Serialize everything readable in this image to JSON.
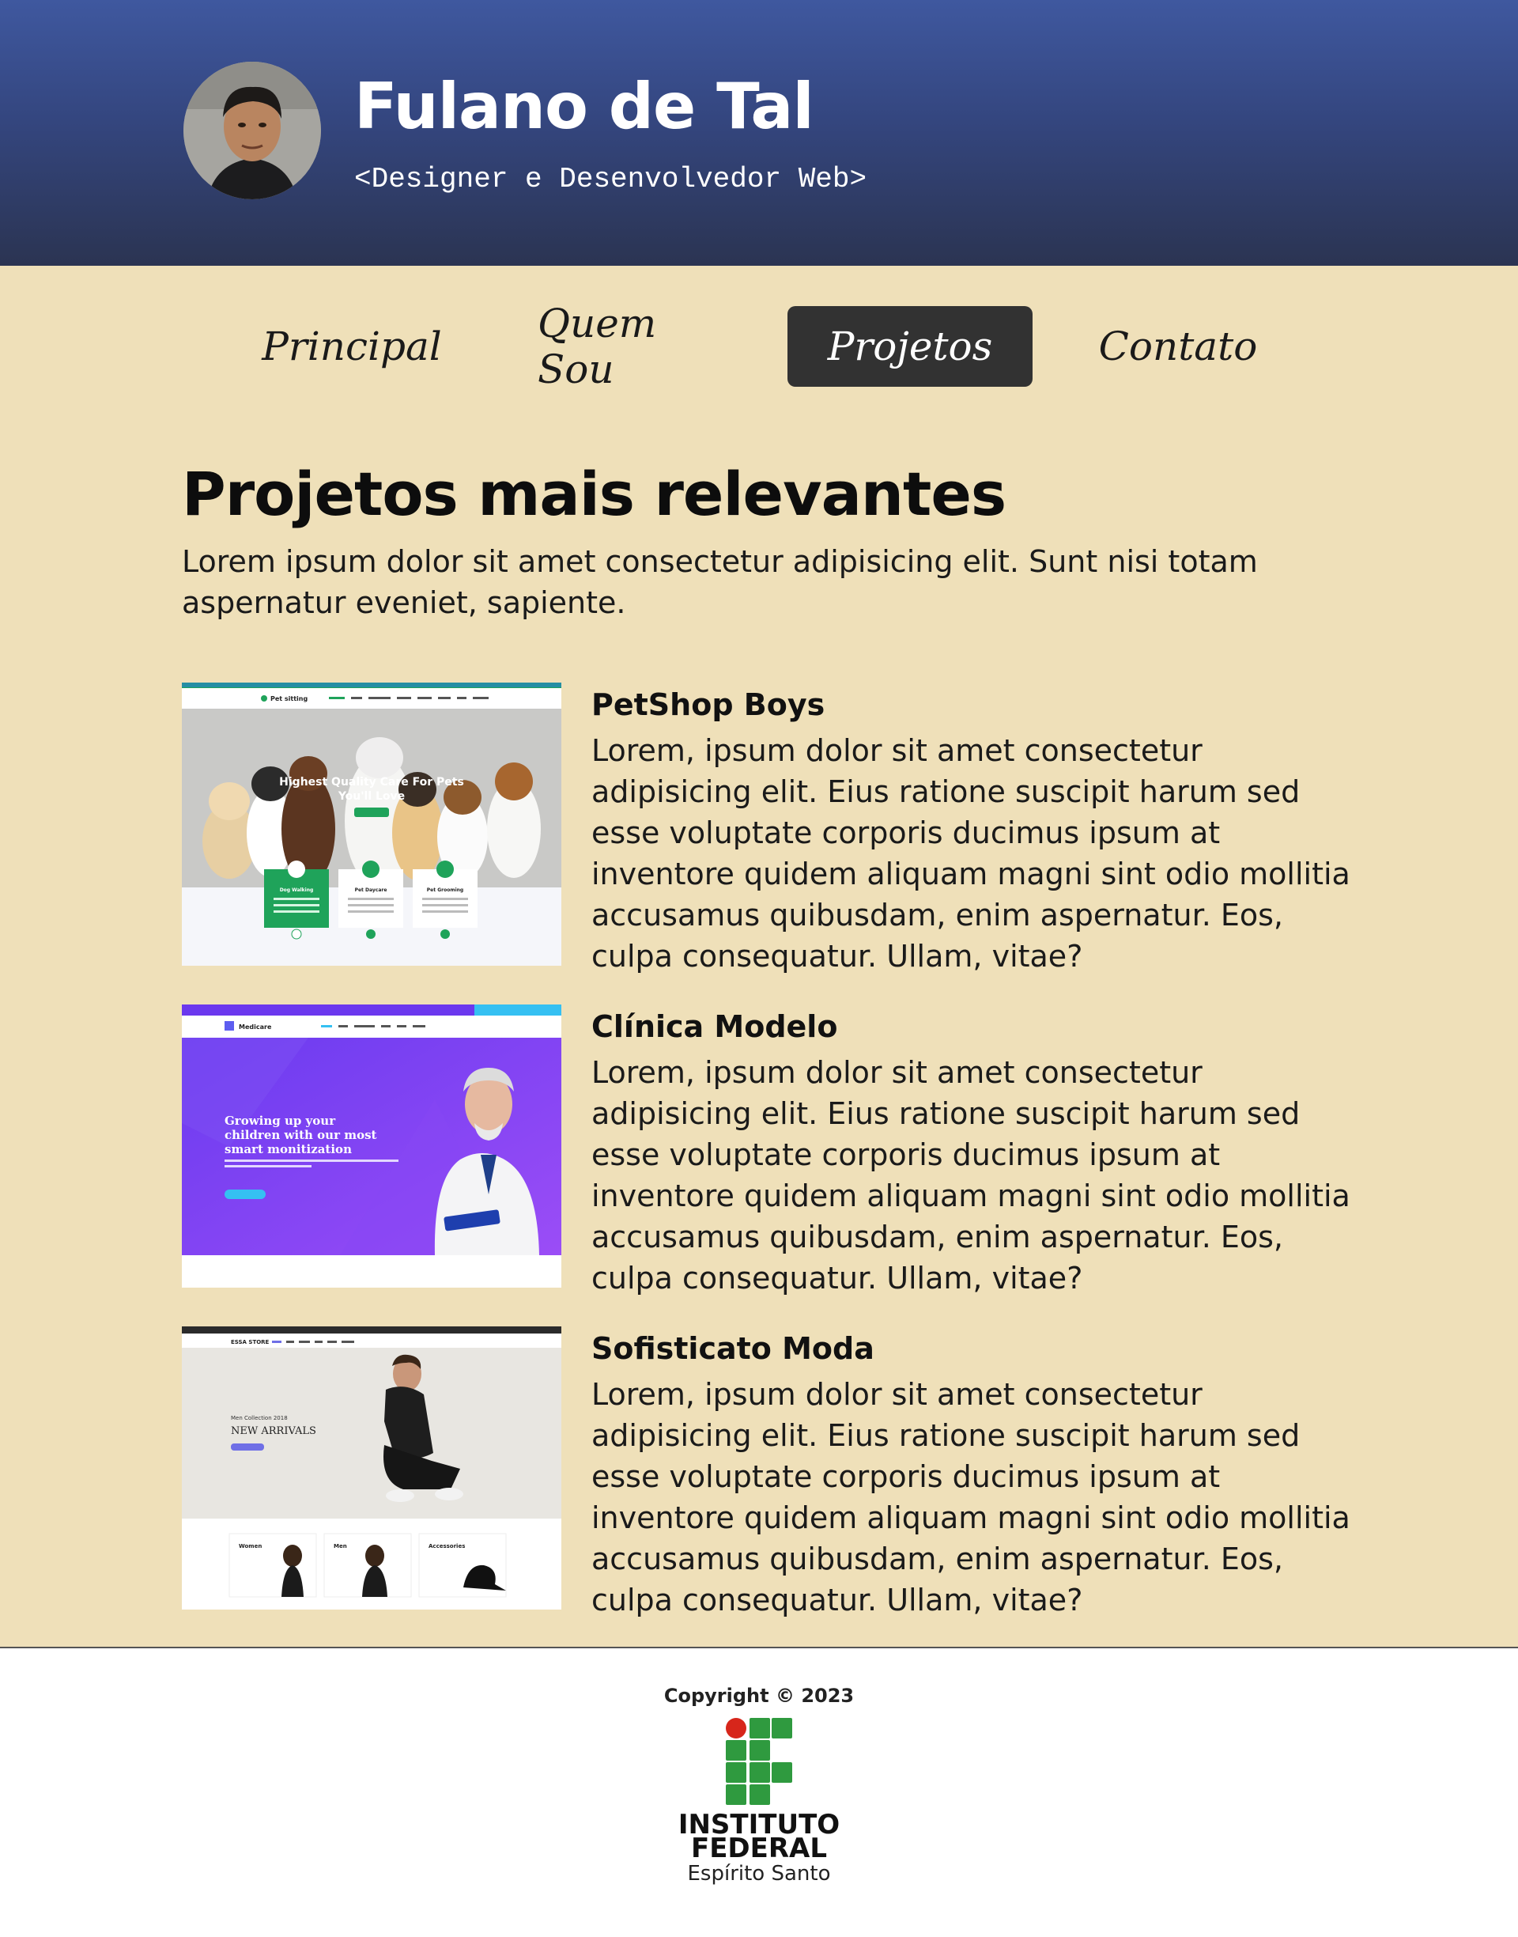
{
  "header": {
    "name": "Fulano de Tal",
    "role": "<Designer e Desenvolvedor Web>"
  },
  "nav": {
    "items": [
      {
        "label": "Principal",
        "active": false
      },
      {
        "label": "Quem Sou",
        "active": false
      },
      {
        "label": "Projetos",
        "active": true
      },
      {
        "label": "Contato",
        "active": false
      }
    ]
  },
  "page": {
    "title": "Projetos mais relevantes",
    "intro": "Lorem ipsum dolor sit amet consectetur adipisicing elit. Sunt nisi totam aspernatur eveniet, sapiente."
  },
  "projects": [
    {
      "title": "PetShop Boys",
      "description": "Lorem, ipsum dolor sit amet consectetur adipisicing elit. Eius ratione suscipit harum sed esse voluptate corporis ducimus ipsum at inventore quidem aliquam magni sint odio mollitia accusamus quibusdam, enim aspernatur. Eos, culpa consequatur. Ullam, vitae?",
      "thumb": {
        "brand": "Pet sitting",
        "headline_1": "Highest Quality Care For Pets",
        "headline_2": "You'll Love",
        "cards": [
          "Dog Walking",
          "Pet Daycare",
          "Pet Grooming"
        ]
      }
    },
    {
      "title": "Clínica Modelo",
      "description": "Lorem, ipsum dolor sit amet consectetur adipisicing elit. Eius ratione suscipit harum sed esse voluptate corporis ducimus ipsum at inventore quidem aliquam magni sint odio mollitia accusamus quibusdam, enim aspernatur. Eos, culpa consequatur. Ullam, vitae?",
      "thumb": {
        "brand": "Medicare",
        "headline_1": "Growing up your",
        "headline_2": "children with our most",
        "headline_3": "smart monitization"
      }
    },
    {
      "title": "Sofisticato Moda",
      "description": "Lorem, ipsum dolor sit amet consectetur adipisicing elit. Eius ratione suscipit harum sed esse voluptate corporis ducimus ipsum at inventore quidem aliquam magni sint odio mollitia accusamus quibusdam, enim aspernatur. Eos, culpa consequatur. Ullam, vitae?",
      "thumb": {
        "brand": "ESSA STORE",
        "kicker": "Men Collection 2018",
        "headline": "NEW ARRIVALS",
        "categories": [
          "Women",
          "Men",
          "Accessories"
        ]
      }
    }
  ],
  "footer": {
    "copyright": "Copyright © 2023",
    "institution_line1": "INSTITUTO",
    "institution_line2": "FEDERAL",
    "institution_line3": "Espírito Santo"
  },
  "colors": {
    "header_top": "#3f589f",
    "header_bottom": "#2b3452",
    "main_bg": "#efe0b9",
    "nav_active_bg": "#323232",
    "if_green": "#2f9a3f",
    "if_red": "#d7261b"
  }
}
